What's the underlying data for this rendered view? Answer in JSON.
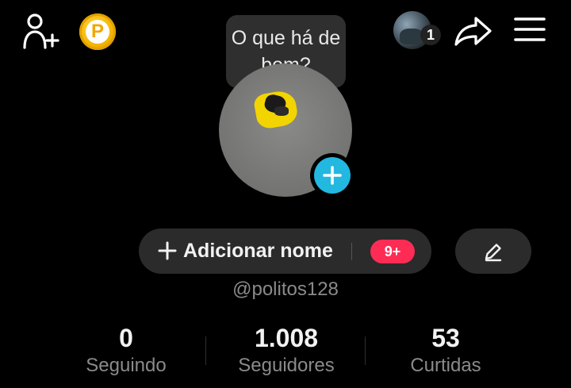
{
  "header": {
    "add_user_icon": "add-user-icon",
    "coin_icon": "coin-p-icon",
    "coin_letter": "P",
    "friend_count": "1",
    "share_icon": "share-icon",
    "menu_icon": "hamburger-menu-icon"
  },
  "tooltip": {
    "text": "O que há de bom?"
  },
  "profile": {
    "add_photo_icon": "plus-icon",
    "add_name_label": "Adicionar nome",
    "notification_badge": "9+",
    "edit_icon": "pencil-icon",
    "username": "@politos128"
  },
  "stats": [
    {
      "value": "0",
      "label": "Seguindo"
    },
    {
      "value": "1.008",
      "label": "Seguidores"
    },
    {
      "value": "53",
      "label": "Curtidas"
    }
  ],
  "colors": {
    "background": "#000000",
    "accent_blue": "#22b8e0",
    "badge_red": "#fe2c55",
    "pill": "#2b2b2b"
  }
}
